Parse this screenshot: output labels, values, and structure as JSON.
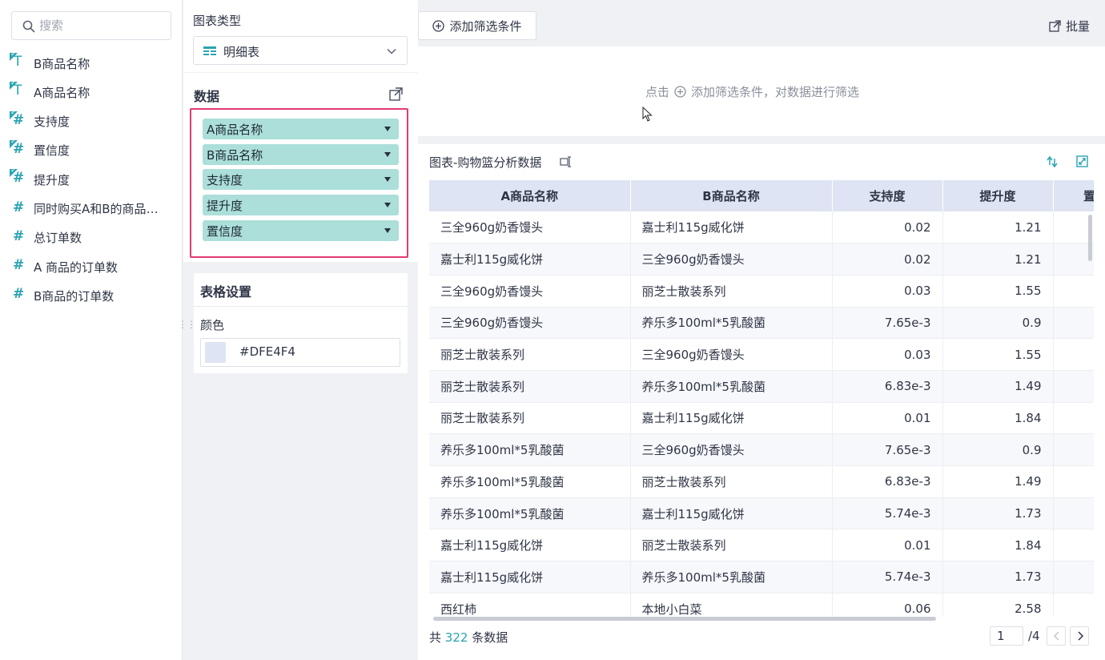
{
  "search": {
    "placeholder": "搜索"
  },
  "fields": [
    {
      "label": "B商品名称",
      "type": "text",
      "checked": true
    },
    {
      "label": "A商品名称",
      "type": "text",
      "checked": true
    },
    {
      "label": "支持度",
      "type": "number",
      "checked": true
    },
    {
      "label": "置信度",
      "type": "number",
      "checked": true
    },
    {
      "label": "提升度",
      "type": "number",
      "checked": true
    },
    {
      "label": "同时购买A和B的商品订单数",
      "type": "number",
      "checked": false
    },
    {
      "label": "总订单数",
      "type": "number",
      "checked": false
    },
    {
      "label": "A 商品的订单数",
      "type": "number",
      "checked": false
    },
    {
      "label": "B商品的订单数",
      "type": "number",
      "checked": false
    }
  ],
  "chart_type": {
    "title": "图表类型",
    "value": "明细表"
  },
  "data_section": {
    "title": "数据",
    "items": [
      "A商品名称",
      "B商品名称",
      "支持度",
      "提升度",
      "置信度"
    ]
  },
  "table_settings": {
    "title": "表格设置",
    "color_label": "颜色",
    "color_value": "#DFE4F4"
  },
  "filter_bar": {
    "add_filter_label": "添加筛选条件",
    "batch_label": "批量",
    "hint_prefix": "点击",
    "hint_suffix": "添加筛选条件，对数据进行筛选"
  },
  "chart": {
    "title": "图表-购物篮分析数据",
    "columns": [
      "A商品名称",
      "B商品名称",
      "支持度",
      "提升度",
      "置"
    ],
    "rows": [
      [
        "三全960g奶香馒头",
        "嘉士利115g威化饼",
        "0.02",
        "1.21"
      ],
      [
        "嘉士利115g威化饼",
        "三全960g奶香馒头",
        "0.02",
        "1.21"
      ],
      [
        "三全960g奶香馒头",
        "丽芝士散装系列",
        "0.03",
        "1.55"
      ],
      [
        "三全960g奶香馒头",
        "养乐多100ml*5乳酸菌",
        "7.65e-3",
        "0.9"
      ],
      [
        "丽芝士散装系列",
        "三全960g奶香馒头",
        "0.03",
        "1.55"
      ],
      [
        "丽芝士散装系列",
        "养乐多100ml*5乳酸菌",
        "6.83e-3",
        "1.49"
      ],
      [
        "丽芝士散装系列",
        "嘉士利115g威化饼",
        "0.01",
        "1.84"
      ],
      [
        "养乐多100ml*5乳酸菌",
        "三全960g奶香馒头",
        "7.65e-3",
        "0.9"
      ],
      [
        "养乐多100ml*5乳酸菌",
        "丽芝士散装系列",
        "6.83e-3",
        "1.49"
      ],
      [
        "养乐多100ml*5乳酸菌",
        "嘉士利115g威化饼",
        "5.74e-3",
        "1.73"
      ],
      [
        "嘉士利115g威化饼",
        "丽芝士散装系列",
        "0.01",
        "1.84"
      ],
      [
        "嘉士利115g威化饼",
        "养乐多100ml*5乳酸菌",
        "5.74e-3",
        "1.73"
      ],
      [
        "西红柿",
        "本地小白菜",
        "0.06",
        "2.58"
      ]
    ]
  },
  "footer": {
    "prefix": "共",
    "count": "322",
    "suffix": "条数据",
    "page": "1",
    "total_pages": "/4"
  },
  "colors": {
    "accent": "#2aa4b2",
    "pill": "#acdfd9",
    "highlight_border": "#e23a72",
    "table_header": "#DFE4F4"
  },
  "icons": {
    "search": "search-icon",
    "text_field": "text-field-icon",
    "number_field": "hash-icon",
    "table_chart": "table-chart-icon",
    "dropdown": "chevron-down-icon",
    "popout": "popout-icon",
    "add": "plus-circle-icon",
    "batch": "batch-edit-icon",
    "sort": "sort-icon",
    "fullscreen": "fullscreen-icon"
  }
}
